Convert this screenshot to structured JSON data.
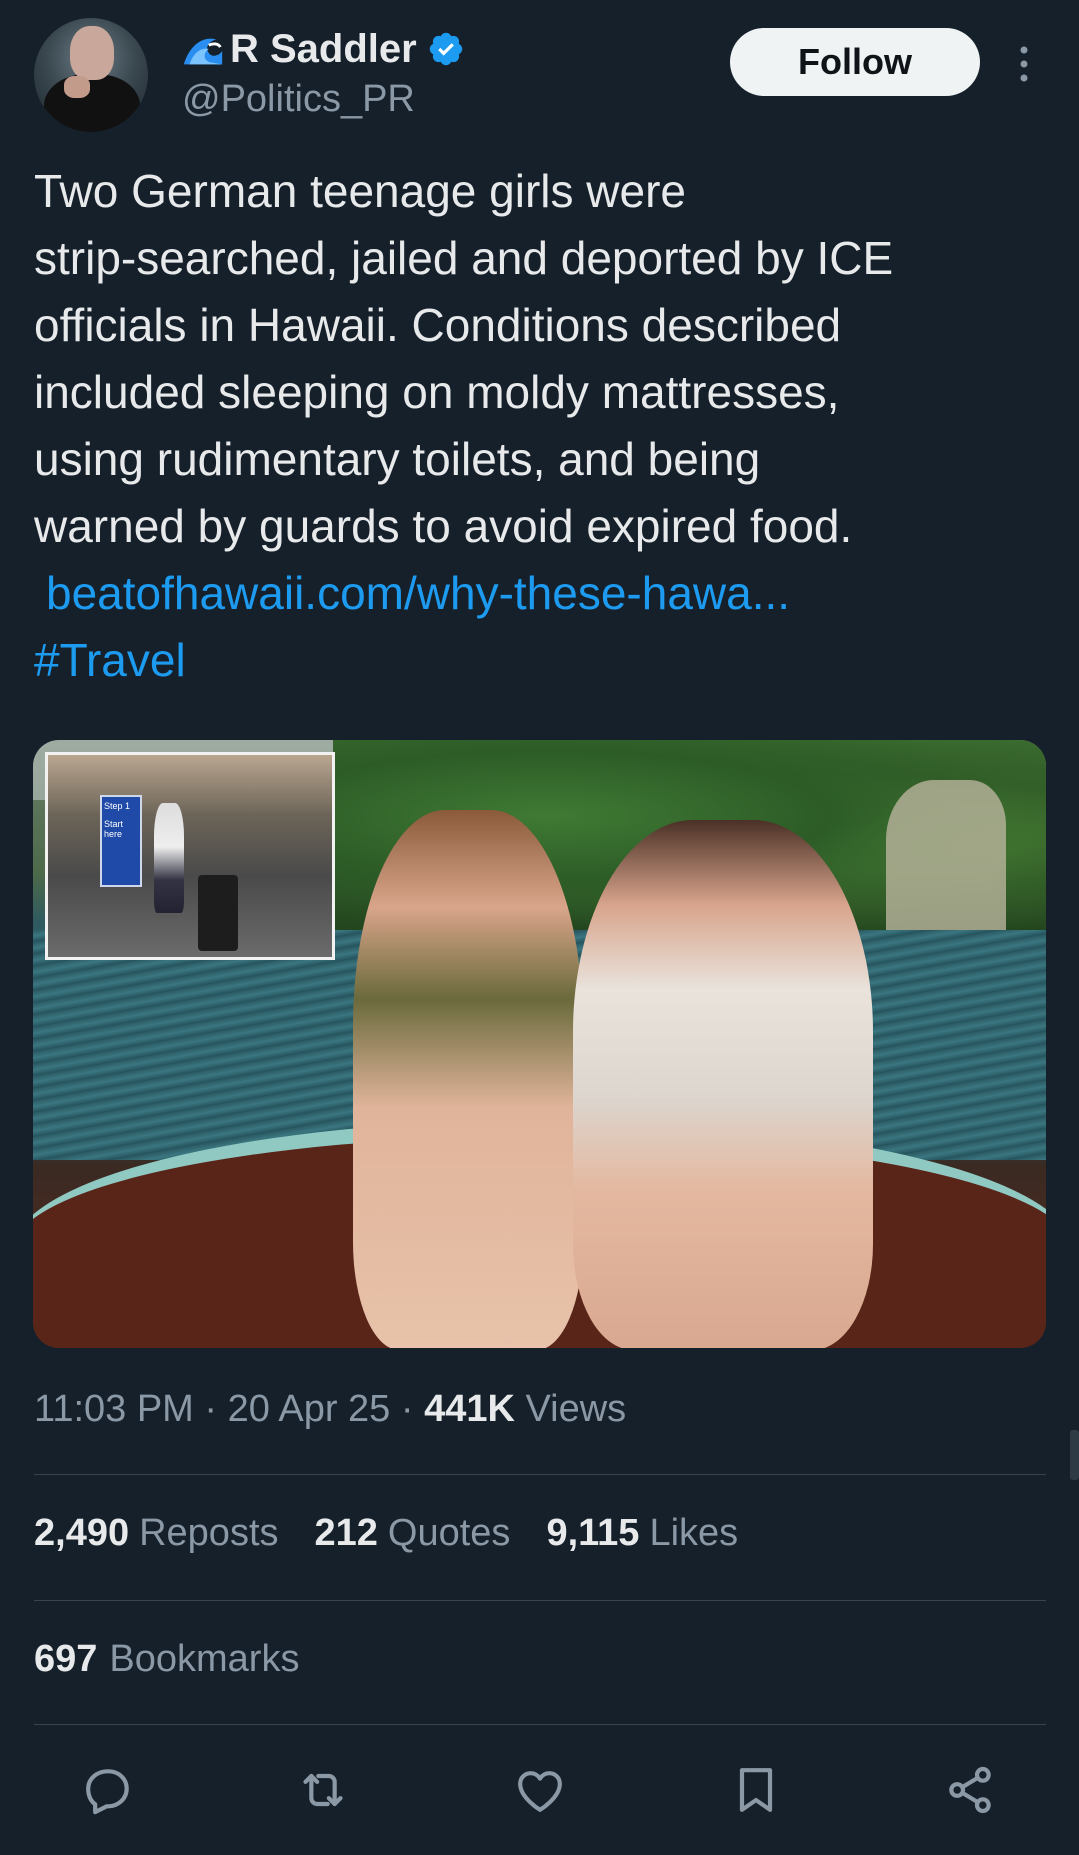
{
  "author": {
    "display_name": "R Saddler",
    "handle": "@Politics_PR",
    "name_emoji": "wave-icon",
    "verified": true,
    "verified_color": "#1d9bf0"
  },
  "header": {
    "follow_label": "Follow"
  },
  "tweet": {
    "lines": [
      "Two German teenage girls were",
      "strip-searched, jailed and deported by ICE",
      "officials in Hawaii. Conditions described",
      "included sleeping on moldy mattresses,",
      "using rudimentary toilets, and being",
      "warned by guards to avoid expired food."
    ],
    "link": "beatofhawaii.com/why-these-hawa...",
    "hashtag": "#Travel",
    "link_color": "#1d9bf0"
  },
  "media": {
    "inset_sign_text_1": "Step 1",
    "inset_sign_text_2": "Start here"
  },
  "meta": {
    "time": "11:03 PM",
    "separator": "·",
    "date": "20 Apr 25",
    "views_count": "441K",
    "views_label": "Views"
  },
  "stats": {
    "reposts_count": "2,490",
    "reposts_label": "Reposts",
    "quotes_count": "212",
    "quotes_label": "Quotes",
    "likes_count": "9,115",
    "likes_label": "Likes",
    "bookmarks_count": "697",
    "bookmarks_label": "Bookmarks"
  },
  "actions": [
    "reply-icon",
    "repost-icon",
    "like-icon",
    "bookmark-icon",
    "share-icon"
  ],
  "colors": {
    "background": "#15202b",
    "secondary_text": "#8b98a5",
    "divider": "#38444d"
  }
}
